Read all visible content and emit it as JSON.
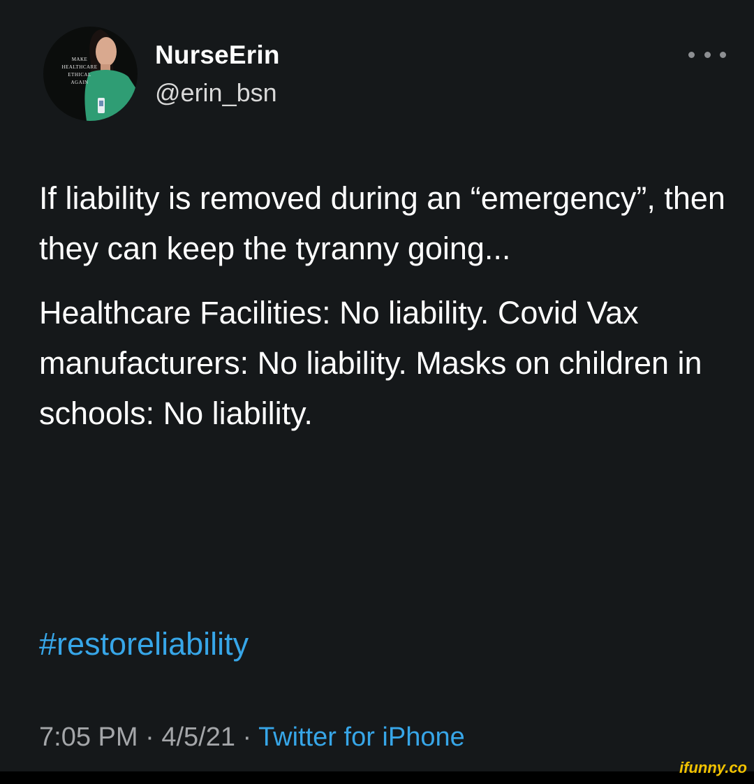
{
  "tweet": {
    "display_name": "NurseErin",
    "handle": "@erin_bsn",
    "avatar_text": [
      "MAKE",
      "HEALTHCARE",
      "ETHICAL",
      "AGAIN"
    ],
    "paragraphs": [
      "If liability is removed during an “emergency”, then they can keep the tyranny going...",
      "Healthcare Facilities: No liability. Covid Vax manufacturers: No liability. Masks on children in schools: No liability."
    ],
    "hashtag": "#restoreliability",
    "time": "7:05 PM",
    "separator": " · ",
    "date": "4/5/21",
    "source": "Twitter for iPhone"
  },
  "watermark": "ifunny.co",
  "colors": {
    "background": "#15181a",
    "text": "#ffffff",
    "secondary_text": "#a4a6a9",
    "link": "#37a6e8",
    "watermark": "#f3c300"
  },
  "icons": {
    "more": "more-horizontal-icon"
  }
}
